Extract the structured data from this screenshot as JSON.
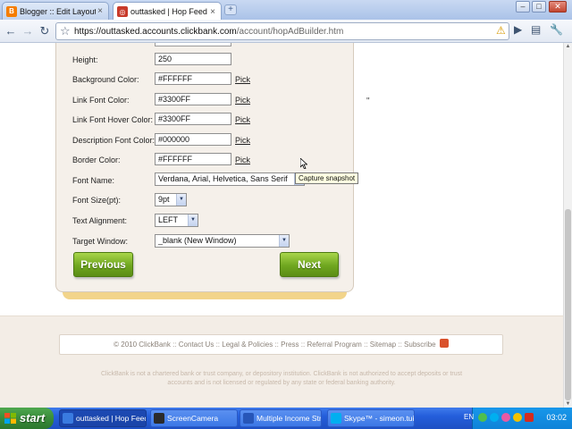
{
  "browser": {
    "tabs": [
      {
        "title": "Blogger :: Edit Layout",
        "favicon": "B",
        "favicon_color": "#f57d00",
        "active": false
      },
      {
        "title": "outtasked | Hop Feed Build...",
        "favicon": "◎",
        "favicon_color": "#c83a2a",
        "active": true
      }
    ],
    "new_tab_label": "+",
    "window_controls": {
      "minimize": "–",
      "maximize": "□",
      "close": "✕"
    },
    "url_domain": "https://outtasked.accounts.clickbank.com",
    "url_path": "/account/hopAdBuilder.htm"
  },
  "form": {
    "height": {
      "label": "Height:",
      "value": "250"
    },
    "colors": [
      {
        "label": "Background Color:",
        "value": "#FFFFFF",
        "pick": "Pick"
      },
      {
        "label": "Link Font Color:",
        "value": "#3300FF",
        "pick": "Pick"
      },
      {
        "label": "Link Font Hover Color:",
        "value": "#3300FF",
        "pick": "Pick"
      },
      {
        "label": "Description Font Color:",
        "value": "#000000",
        "pick": "Pick"
      },
      {
        "label": "Border Color:",
        "value": "#FFFFFF",
        "pick": "Pick"
      }
    ],
    "font_name": {
      "label": "Font Name:",
      "value": "Verdana, Arial, Helvetica, Sans Serif"
    },
    "font_size": {
      "label": "Font Size(pt):",
      "value": "9pt"
    },
    "text_alignment": {
      "label": "Text Alignment:",
      "value": "LEFT"
    },
    "target_window": {
      "label": "Target Window:",
      "value": "_blank (New Window)"
    },
    "previous_label": "Previous",
    "next_label": "Next"
  },
  "stray_text": "\"",
  "tooltip": "Capture snapshot",
  "footer": {
    "links": [
      "© 2010 ClickBank",
      "Contact Us",
      "Legal & Policies",
      "Press",
      "Referral Program",
      "Sitemap",
      "Subscribe"
    ],
    "separator": "::",
    "disclaimer": "ClickBank is not a chartered bank or trust company, or depository institution. ClickBank is not authorized to accept deposits or trust accounts and is not licensed or regulated by any state or federal banking authority."
  },
  "taskbar": {
    "start_label": "start",
    "tasks": [
      {
        "label": "outtasked | Hop Feed...",
        "icon_color": "#3a7be0",
        "active": true
      },
      {
        "label": "ScreenCamera",
        "icon_color": "#2b2b2b",
        "active": false
      },
      {
        "label": "Multiple Income Strea...",
        "icon_color": "#2756b8",
        "active": false
      },
      {
        "label": "Skype™ - simeon.tuilt",
        "icon_color": "#00aff0",
        "active": false
      }
    ],
    "language": "EN",
    "clock": "03:02"
  },
  "colors": {
    "button_green": "#6fa61f",
    "panel_bg": "#f5f0ea",
    "panel_shadow": "#f2d48a",
    "footer_bg": "#f3ede6"
  }
}
